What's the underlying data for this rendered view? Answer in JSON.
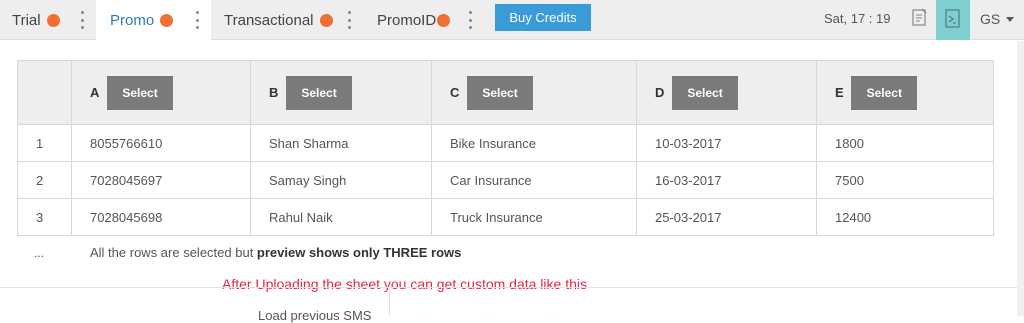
{
  "tabs": [
    {
      "label": "Trial"
    },
    {
      "label": "Promo"
    },
    {
      "label": "Transactional"
    },
    {
      "label": "PromoID"
    }
  ],
  "buy_credits_label": "Buy Credits",
  "clock": "Sat, 17 : 19",
  "user_initials": "GS",
  "colors": {
    "accent": "#3a9bd9",
    "badge": "#f07033",
    "highlight": "#7fcfcf",
    "note": "#e2244a"
  },
  "table": {
    "columns": [
      {
        "letter": "A",
        "button": "Select"
      },
      {
        "letter": "B",
        "button": "Select"
      },
      {
        "letter": "C",
        "button": "Select"
      },
      {
        "letter": "D",
        "button": "Select"
      },
      {
        "letter": "E",
        "button": "Select"
      }
    ],
    "rows": [
      {
        "index": "1",
        "cells": [
          "8055766610",
          "Shan Sharma",
          "Bike Insurance",
          "10-03-2017",
          "1800"
        ]
      },
      {
        "index": "2",
        "cells": [
          "7028045697",
          "Samay Singh",
          "Car Insurance",
          "16-03-2017",
          "7500"
        ]
      },
      {
        "index": "3",
        "cells": [
          "7028045698",
          "Rahul Naik",
          "Truck Insurance",
          "25-03-2017",
          "12400"
        ]
      }
    ],
    "ellipsis": "...",
    "preview_note_prefix": "All the rows are selected but ",
    "preview_note_bold": "preview shows only THREE rows"
  },
  "custom_note": "After Uploading the sheet you can get custom data like this",
  "load_previous": "Load previous SMS"
}
